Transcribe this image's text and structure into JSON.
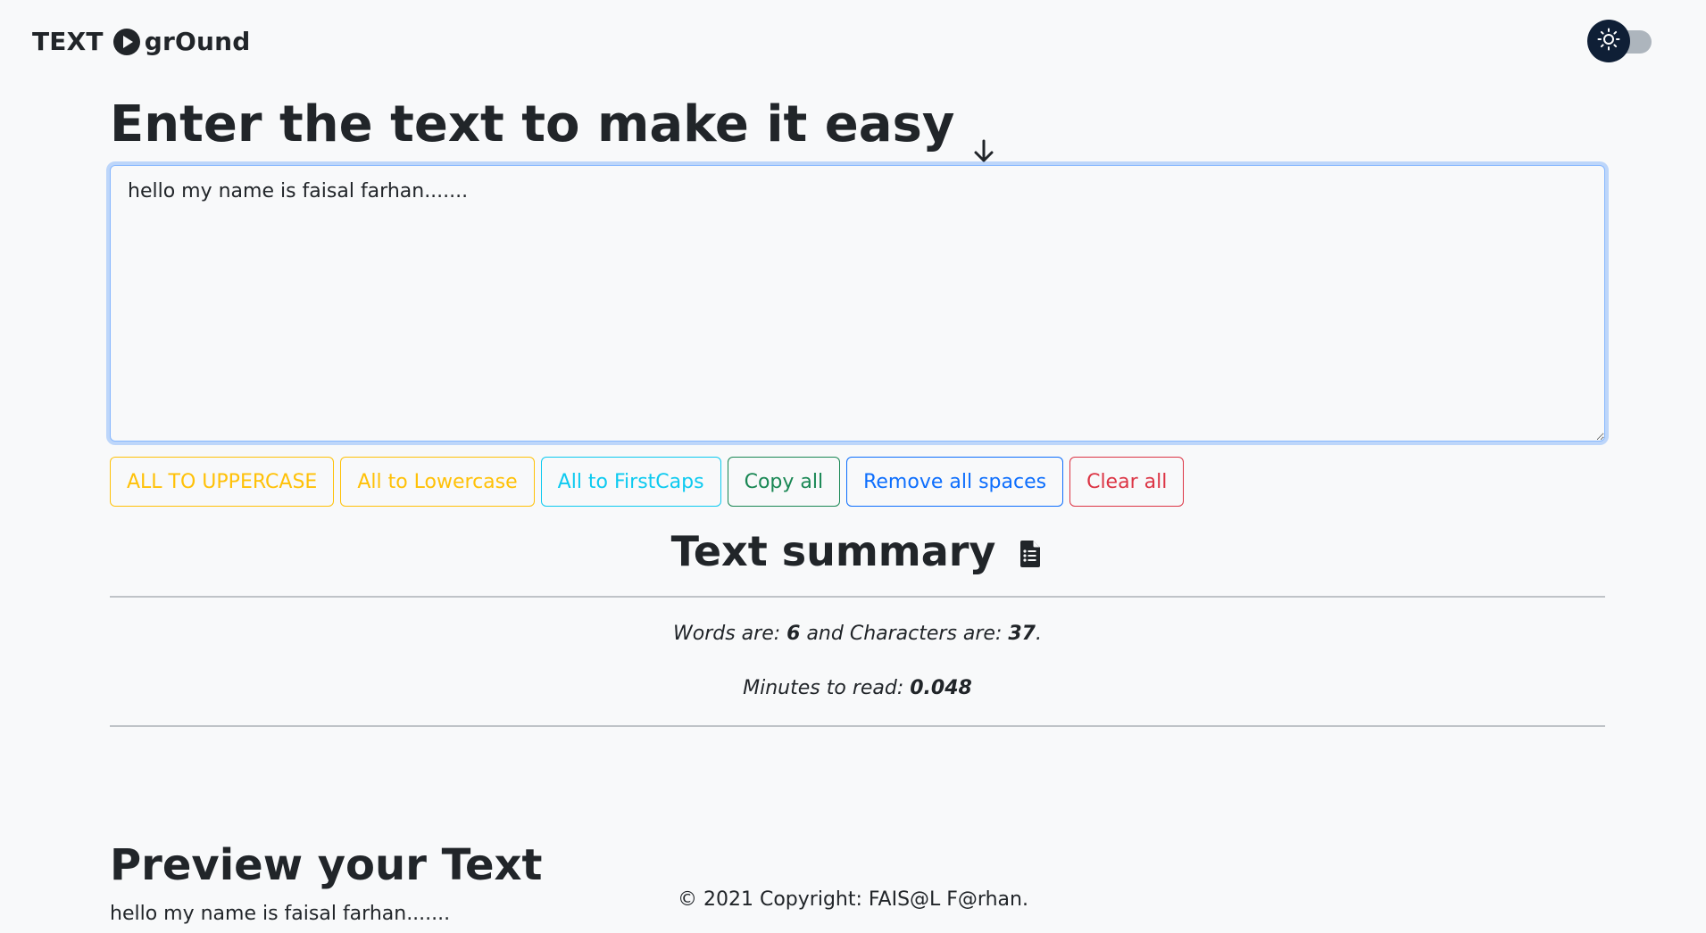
{
  "navbar": {
    "brand_prefix": "TEXT",
    "brand_suffix": "grOund",
    "brand_icon": "play-circle-icon",
    "theme_toggle_icon": "sun-icon"
  },
  "main": {
    "heading": "Enter the text to make it easy",
    "heading_icon": "arrow-down-icon",
    "textarea_value": "hello my name is faisal farhan.......",
    "buttons": [
      {
        "label": "ALL TO UPPERCASE",
        "color": "#ffc107"
      },
      {
        "label": "All to Lowercase",
        "color": "#ffc107"
      },
      {
        "label": "All to FirstCaps",
        "color": "#0dcaf0"
      },
      {
        "label": "Copy all",
        "color": "#198754"
      },
      {
        "label": "Remove all spaces",
        "color": "#0d6efd"
      },
      {
        "label": "Clear all",
        "color": "#dc3545"
      }
    ]
  },
  "summary": {
    "title": "Text summary",
    "title_icon": "file-text-icon",
    "words_prefix": "Words are: ",
    "words_value": "6",
    "chars_prefix": " and Characters are: ",
    "chars_value": "37",
    "chars_suffix": ".",
    "minutes_prefix": "Minutes to read: ",
    "minutes_value": "0.048"
  },
  "preview": {
    "title": "Preview your Text",
    "text": "hello my name is faisal farhan......."
  },
  "footer": {
    "text": "© 2021 Copyright: FAIS@L F@rhan."
  }
}
